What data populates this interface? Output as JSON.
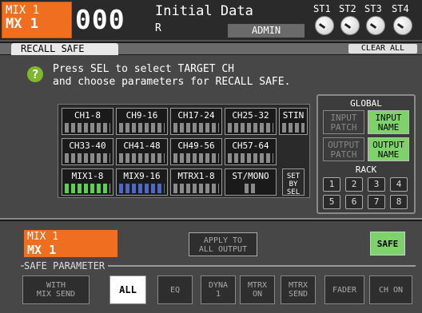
{
  "header": {
    "ch_line1": "MIX 1",
    "ch_line2": "MX 1",
    "scene_number": "000",
    "scene_name": "Initial Data",
    "scene_flag": "R",
    "user": "ADMIN",
    "st_labels": [
      "ST1",
      "ST2",
      "ST3",
      "ST4"
    ]
  },
  "tab": {
    "label": "RECALL SAFE",
    "clear_all": "CLEAR ALL"
  },
  "instruction": "Press SEL to select TARGET CH\nand choose parameters for RECALL SAFE.",
  "channel_grid": [
    [
      "CH1-8",
      "CH9-16",
      "CH17-24",
      "CH25-32",
      "STIN"
    ],
    [
      "CH33-40",
      "CH41-48",
      "CH49-56",
      "CH57-64"
    ],
    [
      "MIX1-8",
      "MIX9-16",
      "MTRX1-8",
      "ST/MONO",
      "SET BY SEL"
    ]
  ],
  "global": {
    "title": "GLOBAL",
    "input_patch": "INPUT PATCH",
    "input_name": "INPUT NAME",
    "output_patch": "OUTPUT PATCH",
    "output_name": "OUTPUT NAME",
    "rack_title": "RACK",
    "racks": [
      "1",
      "2",
      "3",
      "4",
      "5",
      "6",
      "7",
      "8"
    ]
  },
  "selected": {
    "line1": "MIX 1",
    "line2": "MX 1"
  },
  "apply_all": "APPLY TO\nALL OUTPUT",
  "safe": "SAFE",
  "safe_parameter": {
    "title": "SAFE PARAMETER",
    "buttons": [
      "WITH\nMIX SEND",
      "ALL",
      "EQ",
      "DYNA\n1",
      "MTRX\nON",
      "MTRX\nSEND",
      "FADER",
      "CH ON"
    ]
  }
}
